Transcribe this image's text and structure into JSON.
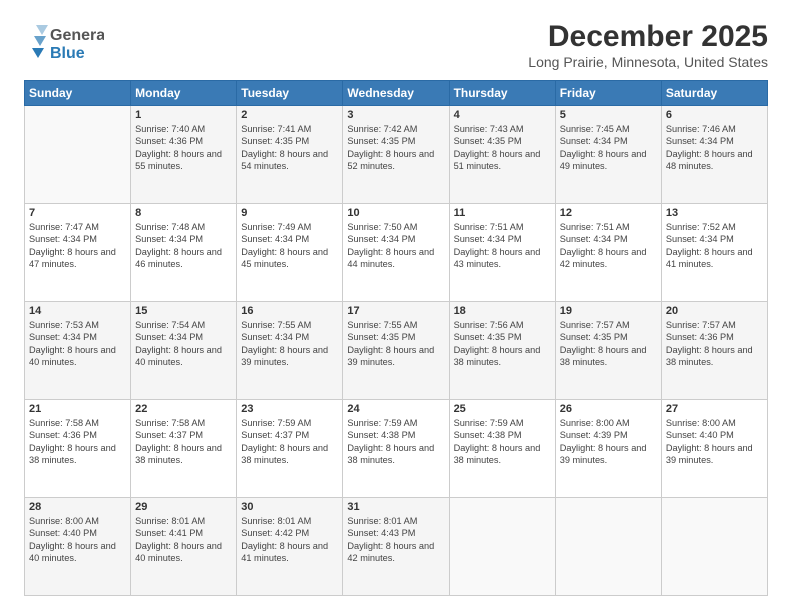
{
  "header": {
    "logo_general": "General",
    "logo_blue": "Blue",
    "main_title": "December 2025",
    "subtitle": "Long Prairie, Minnesota, United States"
  },
  "days_of_week": [
    "Sunday",
    "Monday",
    "Tuesday",
    "Wednesday",
    "Thursday",
    "Friday",
    "Saturday"
  ],
  "weeks": [
    [
      {
        "day": "",
        "sunrise": "",
        "sunset": "",
        "daylight": ""
      },
      {
        "day": "1",
        "sunrise": "Sunrise: 7:40 AM",
        "sunset": "Sunset: 4:36 PM",
        "daylight": "Daylight: 8 hours and 55 minutes."
      },
      {
        "day": "2",
        "sunrise": "Sunrise: 7:41 AM",
        "sunset": "Sunset: 4:35 PM",
        "daylight": "Daylight: 8 hours and 54 minutes."
      },
      {
        "day": "3",
        "sunrise": "Sunrise: 7:42 AM",
        "sunset": "Sunset: 4:35 PM",
        "daylight": "Daylight: 8 hours and 52 minutes."
      },
      {
        "day": "4",
        "sunrise": "Sunrise: 7:43 AM",
        "sunset": "Sunset: 4:35 PM",
        "daylight": "Daylight: 8 hours and 51 minutes."
      },
      {
        "day": "5",
        "sunrise": "Sunrise: 7:45 AM",
        "sunset": "Sunset: 4:34 PM",
        "daylight": "Daylight: 8 hours and 49 minutes."
      },
      {
        "day": "6",
        "sunrise": "Sunrise: 7:46 AM",
        "sunset": "Sunset: 4:34 PM",
        "daylight": "Daylight: 8 hours and 48 minutes."
      }
    ],
    [
      {
        "day": "7",
        "sunrise": "Sunrise: 7:47 AM",
        "sunset": "Sunset: 4:34 PM",
        "daylight": "Daylight: 8 hours and 47 minutes."
      },
      {
        "day": "8",
        "sunrise": "Sunrise: 7:48 AM",
        "sunset": "Sunset: 4:34 PM",
        "daylight": "Daylight: 8 hours and 46 minutes."
      },
      {
        "day": "9",
        "sunrise": "Sunrise: 7:49 AM",
        "sunset": "Sunset: 4:34 PM",
        "daylight": "Daylight: 8 hours and 45 minutes."
      },
      {
        "day": "10",
        "sunrise": "Sunrise: 7:50 AM",
        "sunset": "Sunset: 4:34 PM",
        "daylight": "Daylight: 8 hours and 44 minutes."
      },
      {
        "day": "11",
        "sunrise": "Sunrise: 7:51 AM",
        "sunset": "Sunset: 4:34 PM",
        "daylight": "Daylight: 8 hours and 43 minutes."
      },
      {
        "day": "12",
        "sunrise": "Sunrise: 7:51 AM",
        "sunset": "Sunset: 4:34 PM",
        "daylight": "Daylight: 8 hours and 42 minutes."
      },
      {
        "day": "13",
        "sunrise": "Sunrise: 7:52 AM",
        "sunset": "Sunset: 4:34 PM",
        "daylight": "Daylight: 8 hours and 41 minutes."
      }
    ],
    [
      {
        "day": "14",
        "sunrise": "Sunrise: 7:53 AM",
        "sunset": "Sunset: 4:34 PM",
        "daylight": "Daylight: 8 hours and 40 minutes."
      },
      {
        "day": "15",
        "sunrise": "Sunrise: 7:54 AM",
        "sunset": "Sunset: 4:34 PM",
        "daylight": "Daylight: 8 hours and 40 minutes."
      },
      {
        "day": "16",
        "sunrise": "Sunrise: 7:55 AM",
        "sunset": "Sunset: 4:34 PM",
        "daylight": "Daylight: 8 hours and 39 minutes."
      },
      {
        "day": "17",
        "sunrise": "Sunrise: 7:55 AM",
        "sunset": "Sunset: 4:35 PM",
        "daylight": "Daylight: 8 hours and 39 minutes."
      },
      {
        "day": "18",
        "sunrise": "Sunrise: 7:56 AM",
        "sunset": "Sunset: 4:35 PM",
        "daylight": "Daylight: 8 hours and 38 minutes."
      },
      {
        "day": "19",
        "sunrise": "Sunrise: 7:57 AM",
        "sunset": "Sunset: 4:35 PM",
        "daylight": "Daylight: 8 hours and 38 minutes."
      },
      {
        "day": "20",
        "sunrise": "Sunrise: 7:57 AM",
        "sunset": "Sunset: 4:36 PM",
        "daylight": "Daylight: 8 hours and 38 minutes."
      }
    ],
    [
      {
        "day": "21",
        "sunrise": "Sunrise: 7:58 AM",
        "sunset": "Sunset: 4:36 PM",
        "daylight": "Daylight: 8 hours and 38 minutes."
      },
      {
        "day": "22",
        "sunrise": "Sunrise: 7:58 AM",
        "sunset": "Sunset: 4:37 PM",
        "daylight": "Daylight: 8 hours and 38 minutes."
      },
      {
        "day": "23",
        "sunrise": "Sunrise: 7:59 AM",
        "sunset": "Sunset: 4:37 PM",
        "daylight": "Daylight: 8 hours and 38 minutes."
      },
      {
        "day": "24",
        "sunrise": "Sunrise: 7:59 AM",
        "sunset": "Sunset: 4:38 PM",
        "daylight": "Daylight: 8 hours and 38 minutes."
      },
      {
        "day": "25",
        "sunrise": "Sunrise: 7:59 AM",
        "sunset": "Sunset: 4:38 PM",
        "daylight": "Daylight: 8 hours and 38 minutes."
      },
      {
        "day": "26",
        "sunrise": "Sunrise: 8:00 AM",
        "sunset": "Sunset: 4:39 PM",
        "daylight": "Daylight: 8 hours and 39 minutes."
      },
      {
        "day": "27",
        "sunrise": "Sunrise: 8:00 AM",
        "sunset": "Sunset: 4:40 PM",
        "daylight": "Daylight: 8 hours and 39 minutes."
      }
    ],
    [
      {
        "day": "28",
        "sunrise": "Sunrise: 8:00 AM",
        "sunset": "Sunset: 4:40 PM",
        "daylight": "Daylight: 8 hours and 40 minutes."
      },
      {
        "day": "29",
        "sunrise": "Sunrise: 8:01 AM",
        "sunset": "Sunset: 4:41 PM",
        "daylight": "Daylight: 8 hours and 40 minutes."
      },
      {
        "day": "30",
        "sunrise": "Sunrise: 8:01 AM",
        "sunset": "Sunset: 4:42 PM",
        "daylight": "Daylight: 8 hours and 41 minutes."
      },
      {
        "day": "31",
        "sunrise": "Sunrise: 8:01 AM",
        "sunset": "Sunset: 4:43 PM",
        "daylight": "Daylight: 8 hours and 42 minutes."
      },
      {
        "day": "",
        "sunrise": "",
        "sunset": "",
        "daylight": ""
      },
      {
        "day": "",
        "sunrise": "",
        "sunset": "",
        "daylight": ""
      },
      {
        "day": "",
        "sunrise": "",
        "sunset": "",
        "daylight": ""
      }
    ]
  ]
}
